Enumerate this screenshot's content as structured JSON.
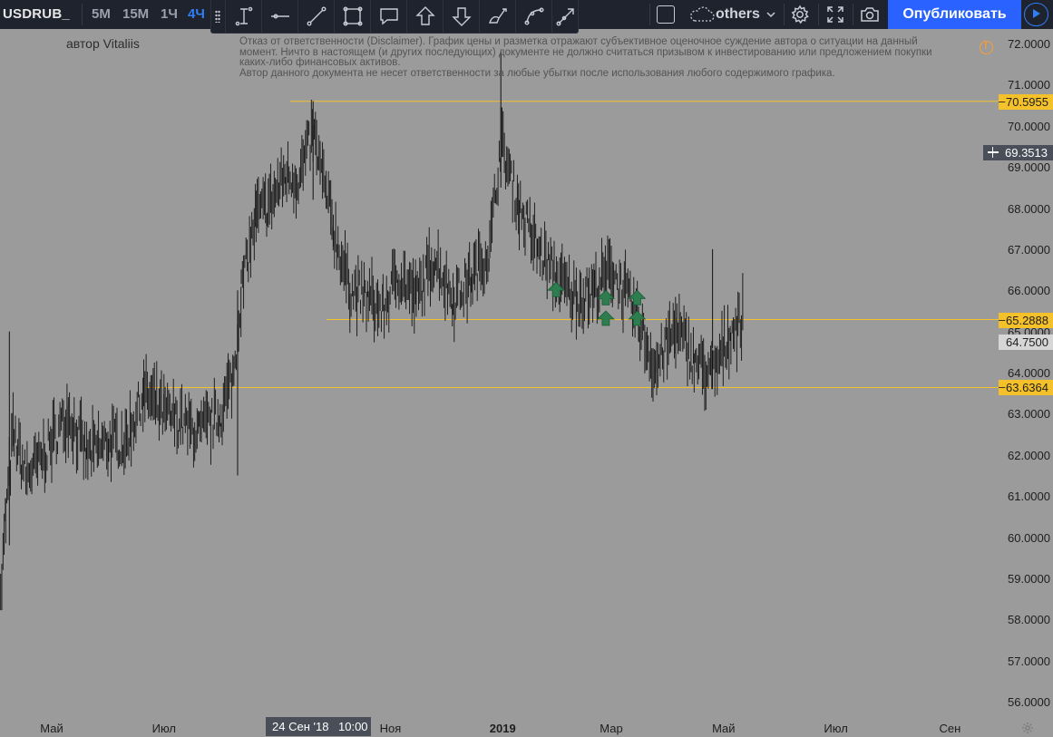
{
  "toolbar": {
    "symbol": "USDRUB_",
    "intervals": [
      "5М",
      "15М",
      "1Ч",
      "4Ч"
    ],
    "active_interval": "4Ч",
    "drawing_tools": [
      "text-cursor-icon",
      "horizontal-line-icon",
      "trend-line-icon",
      "rectangle-icon",
      "callout-icon",
      "arrow-up-icon",
      "arrow-down-icon",
      "brush-icon",
      "curve-icon",
      "ray-icon"
    ],
    "workspace": "others",
    "publish_label": "Опубликовать",
    "accent_color": "#2962ff"
  },
  "chart": {
    "author": "автор Vitaliis",
    "disclaimer": [
      "Отказ от ответственности (Disclaimer). График цены и разметка отражают субъективное оценочное суждение автора о ситуации на данный",
      "момент. Ничто в настоящем (и других последующих) документе не должно считаться призывом к инвестированию или предложением покупки",
      "каких-либо финансовых активов.",
      "Автор данного документа не несет ответственности за любые убытки после использования любого содержимого графика."
    ],
    "background_color": "#9b9b9b",
    "level_color": "#f5c12a"
  },
  "chart_data": {
    "type": "line",
    "title": "",
    "price_ticks": [
      "72.0000",
      "71.0000",
      "70.0000",
      "69.0000",
      "68.0000",
      "67.0000",
      "66.0000",
      "65.0000",
      "64.0000",
      "63.0000",
      "62.0000",
      "61.0000",
      "60.0000",
      "59.0000",
      "58.0000",
      "57.0000",
      "56.0000"
    ],
    "time_ticks": [
      "Май",
      "Июл",
      "Ноя",
      "2019",
      "Мар",
      "Май",
      "Июл",
      "Сен"
    ],
    "ylim": [
      55.6,
      72.3
    ],
    "horizontal_levels": [
      "70.5955",
      "65.2888",
      "63.6364"
    ],
    "crosshair_price": "69.3513",
    "crosshair_date": "24 Сен '18",
    "crosshair_time": "10:00",
    "last_price": "64.7500",
    "series": [
      {
        "dates": [
          "2018-04-02",
          "2018-04-06",
          "2018-04-10",
          "2018-04-17",
          "2018-04-24",
          "2018-05-01",
          "2018-05-10",
          "2018-05-20",
          "2018-06-01",
          "2018-06-10",
          "2018-06-20",
          "2018-07-01",
          "2018-07-10",
          "2018-07-20",
          "2018-08-01",
          "2018-08-08",
          "2018-08-12",
          "2018-08-20",
          "2018-08-26",
          "2018-09-05",
          "2018-09-12",
          "2018-09-20",
          "2018-10-01",
          "2018-10-10",
          "2018-10-20",
          "2018-10-28",
          "2018-11-05",
          "2018-11-15",
          "2018-11-25",
          "2018-12-05",
          "2018-12-15",
          "2018-12-25",
          "2018-12-31",
          "2019-01-10",
          "2019-01-20",
          "2019-02-01",
          "2019-02-10",
          "2019-02-20",
          "2019-03-01",
          "2019-03-10",
          "2019-03-16",
          "2019-03-25",
          "2019-04-05",
          "2019-04-15",
          "2019-04-25",
          "2019-05-05",
          "2019-05-12"
        ],
        "values": [
          57.5,
          60.5,
          62.5,
          61.5,
          61.8,
          62.3,
          63.0,
          62.0,
          62.3,
          62.3,
          63.5,
          63.0,
          62.8,
          62.5,
          63.0,
          64.0,
          66.0,
          67.8,
          68.0,
          68.8,
          68.7,
          69.8,
          67.5,
          66.0,
          65.8,
          65.5,
          66.4,
          65.8,
          66.8,
          65.8,
          66.3,
          67.0,
          69.6,
          68.0,
          67.0,
          66.2,
          65.8,
          66.0,
          66.5,
          65.8,
          65.2,
          64.1,
          65.1,
          64.3,
          63.9,
          65.0,
          65.3
        ]
      }
    ],
    "markers": {
      "type": "arrow-up",
      "color": "#2e7d4f",
      "dates": [
        "2019-01-30",
        "2019-02-26",
        "2019-02-26",
        "2019-03-15",
        "2019-03-15"
      ],
      "values": [
        66.0,
        65.8,
        65.3,
        65.8,
        65.3
      ]
    }
  }
}
